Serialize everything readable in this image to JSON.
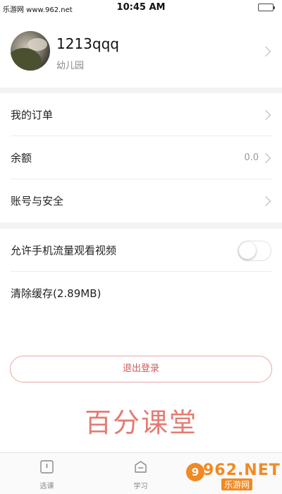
{
  "status_bar": {
    "watermark": "乐游网 www.962.net",
    "time": "10:45 AM",
    "battery_level": 1.0,
    "battery_color": "#4cd964"
  },
  "profile": {
    "name": "1213qqq",
    "subtitle": "幼儿园",
    "chevron_icon": "chevron-right-icon"
  },
  "menu_group_1": [
    {
      "label": "我的订单",
      "value": "",
      "icon": "chevron-right-icon"
    },
    {
      "label": "余额",
      "value": "0.0",
      "icon": "chevron-right-icon"
    },
    {
      "label": "账号与安全",
      "value": "",
      "icon": "chevron-right-icon"
    }
  ],
  "menu_group_2": {
    "mobile_data_label": "允许手机流量观看视频",
    "mobile_data_enabled": false,
    "clear_cache_label": "清除缓存(2.89MB)"
  },
  "logout_label": "退出登录",
  "brand_watermark": "百分课堂",
  "tabs": [
    {
      "label": "选课",
      "icon": "course-select-icon"
    },
    {
      "label": "学习",
      "icon": "study-icon"
    }
  ],
  "site_badge": {
    "top": "962.NET",
    "bottom": "乐游网",
    "dot": "9"
  },
  "colors": {
    "accent_red": "#d25a5a",
    "logout_border": "#e9a7a7",
    "brand_pink": "#e47b73",
    "section_gap": "#f3f3f3"
  }
}
